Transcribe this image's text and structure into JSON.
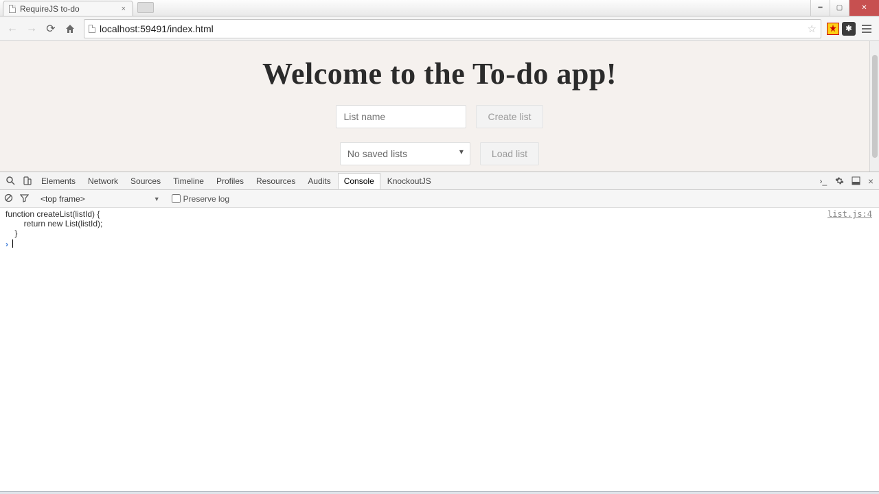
{
  "browser": {
    "tab_title": "RequireJS to-do",
    "url": "localhost:59491/index.html"
  },
  "page": {
    "heading": "Welcome to the To-do app!",
    "list_name_placeholder": "List name",
    "create_button": "Create list",
    "select_default": "No saved lists",
    "load_button": "Load list"
  },
  "devtools": {
    "tabs": [
      "Elements",
      "Network",
      "Sources",
      "Timeline",
      "Profiles",
      "Resources",
      "Audits",
      "Console",
      "KnockoutJS"
    ],
    "active_tab": "Console",
    "frame": "<top frame>",
    "preserve_log_label": "Preserve log",
    "preserve_log_checked": false,
    "console": {
      "code": "function createList(listId) {\n        return new List(listId);\n    }",
      "source_ref": "list.js:4"
    }
  }
}
